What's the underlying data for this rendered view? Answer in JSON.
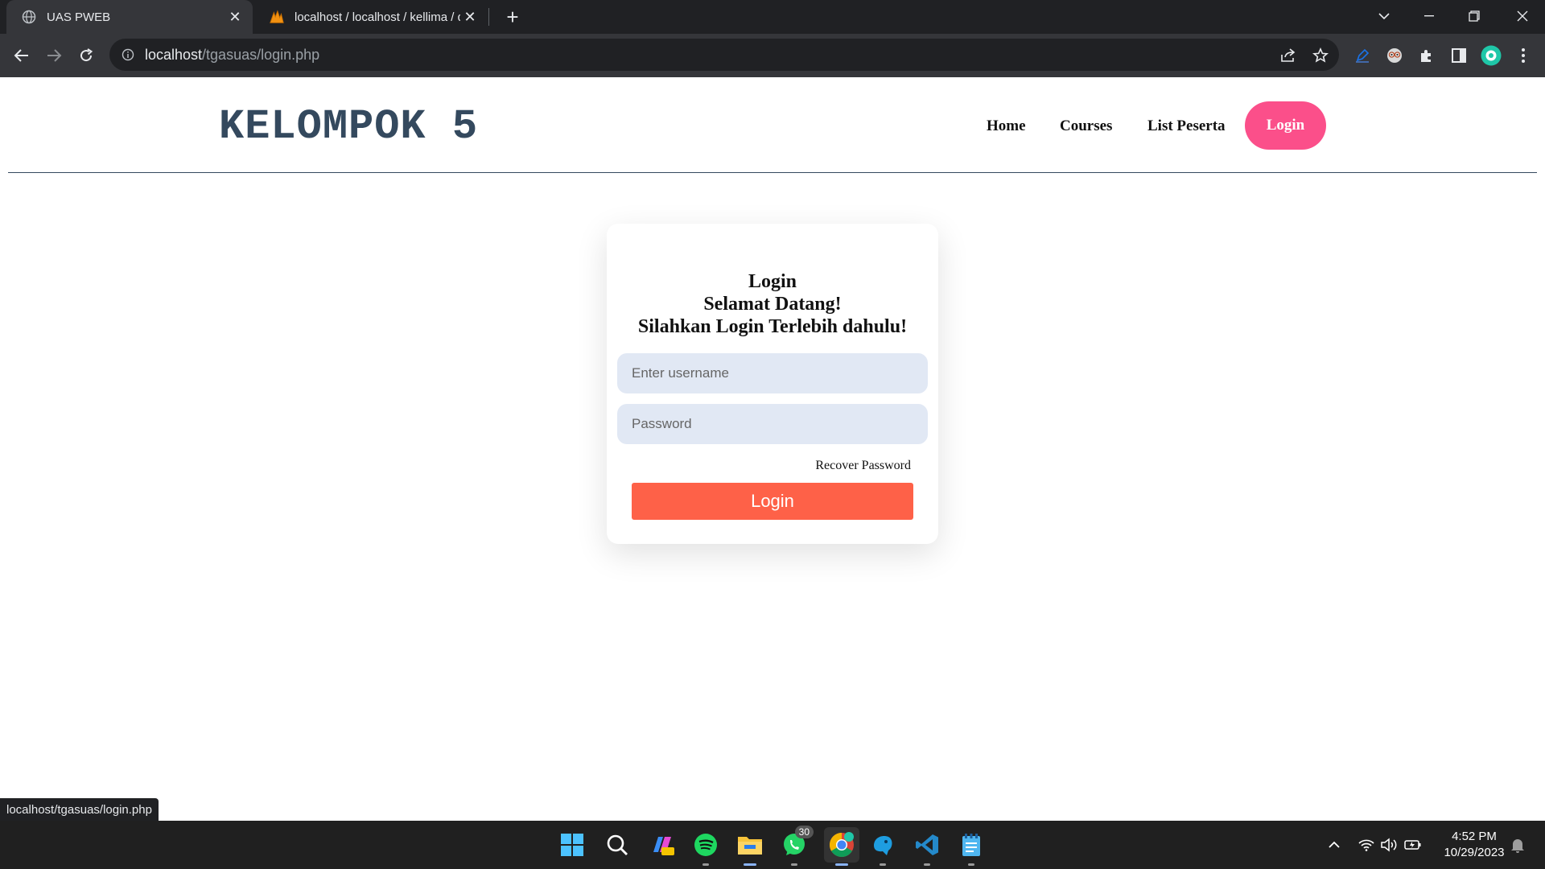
{
  "browser": {
    "tabs": [
      {
        "title": "UAS PWEB",
        "active": true,
        "icon": "globe-icon"
      },
      {
        "title": "localhost / localhost / kellima / d",
        "active": false,
        "icon": "phpmyadmin-icon"
      }
    ],
    "address": {
      "host": "localhost",
      "path": "/tgasuas/login.php"
    },
    "status_url": "localhost/tgasuas/login.php"
  },
  "page": {
    "brand": "KELOMPOK 5",
    "nav": {
      "home": "Home",
      "courses": "Courses",
      "participants": "List Peserta",
      "login": "Login"
    },
    "login_card": {
      "title_line1": "Login",
      "title_line2": "Selamat Datang!",
      "title_line3": "Silahkan Login Terlebih dahulu!",
      "username_placeholder": "Enter username",
      "password_placeholder": "Password",
      "recover": "Recover Password",
      "submit": "Login"
    }
  },
  "taskbar": {
    "whatsapp_badge": "30",
    "time": "4:52 PM",
    "date": "10/29/2023"
  },
  "colors": {
    "brand": "#34495e",
    "nav_login_bg": "#fb4f8a",
    "submit_bg": "#fe6148",
    "field_bg": "#e1e8f4"
  }
}
